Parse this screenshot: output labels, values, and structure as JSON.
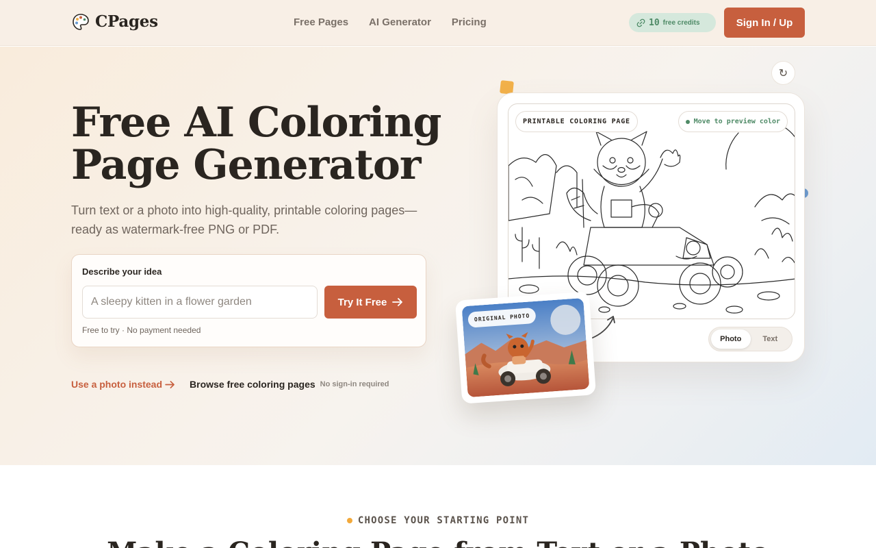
{
  "header": {
    "brand": "CPages",
    "nav": [
      "Free Pages",
      "AI Generator",
      "Pricing"
    ],
    "credits_count": "10",
    "credits_label": "free credits",
    "signin_label": "Sign In / Up"
  },
  "hero": {
    "title": "Free AI Coloring Page Generator",
    "subtitle": "Turn text or a photo into high-quality, printable coloring pages—ready as watermark-free PNG or PDF.",
    "idea_label": "Describe your idea",
    "idea_placeholder": "A sleepy kitten in a flower garden",
    "try_label": "Try It Free",
    "note": "Free to try · No payment needed",
    "use_photo": "Use a photo instead",
    "browse": "Browse free coloring pages",
    "no_signin": "No sign-in required"
  },
  "preview": {
    "tag_printable": "PRINTABLE COLORING PAGE",
    "tag_hover": "Move to preview color",
    "toggle": [
      "Photo",
      "Text"
    ],
    "tag_original": "ORIGINAL PHOTO",
    "reset_icon": "refresh-icon"
  },
  "next_section": {
    "eyebrow": "CHOOSE YOUR STARTING POINT",
    "title": "Make a Coloring Page from Text or a Photo"
  },
  "colors": {
    "accent": "#c75f3e",
    "green": "#4e8a66",
    "yellow": "#f2b14a",
    "blue": "#6b9bd1"
  }
}
